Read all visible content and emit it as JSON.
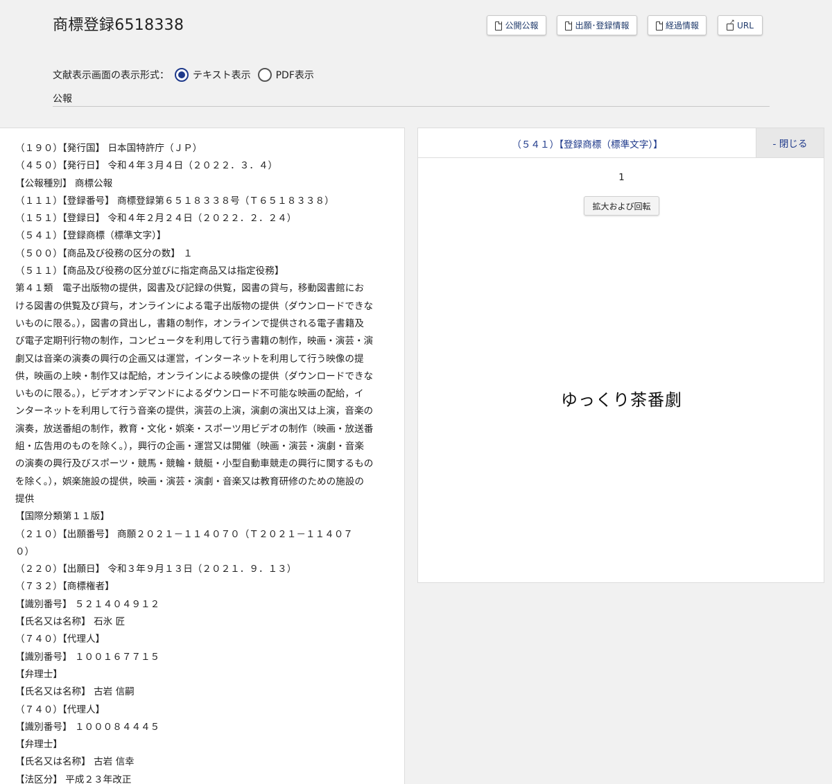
{
  "header": {
    "title": "商標登録6518338",
    "buttons": [
      {
        "label": "公開公報",
        "icon": "document-icon"
      },
      {
        "label": "出願･登録情報",
        "icon": "document-icon"
      },
      {
        "label": "経過情報",
        "icon": "document-icon"
      },
      {
        "label": "URL",
        "icon": "external-link-icon"
      }
    ]
  },
  "display_format": {
    "label": "文献表示画面の表示形式：",
    "options": [
      {
        "label": "テキスト表示",
        "selected": true
      },
      {
        "label": "PDF表示",
        "selected": false
      }
    ]
  },
  "section_label": "公報",
  "document_lines": [
    "（１９０）【発行国】 日本国特許庁（ＪＰ）",
    "（４５０）【発行日】 令和４年３月４日（２０２２．３．４）",
    "【公報種別】 商標公報",
    "（１１１）【登録番号】 商標登録第６５１８３３８号（Ｔ６５１８３３８）",
    "（１５１）【登録日】 令和４年２月２４日（２０２２．２．２４）",
    "（５４１）【登録商標（標準文字）】",
    "（５００）【商品及び役務の区分の数】 １",
    "（５１１）【商品及び役務の区分並びに指定商品又は指定役務】",
    "第４１類　電子出版物の提供，図書及び記録の供覧，図書の貸与，移動図書館にお",
    "ける図書の供覧及び貸与，オンラインによる電子出版物の提供（ダウンロードできな",
    "いものに限る。），図書の貸出し，書籍の制作，オンラインで提供される電子書籍及",
    "び電子定期刊行物の制作，コンピュータを利用して行う書籍の制作，映画・演芸・演",
    "劇又は音楽の演奏の興行の企画又は運営，インターネットを利用して行う映像の提",
    "供，映画の上映・制作又は配給，オンラインによる映像の提供（ダウンロードできな",
    "いものに限る。），ビデオオンデマンドによるダウンロード不可能な映画の配給，イ",
    "ンターネットを利用して行う音楽の提供，演芸の上演，演劇の演出又は上演，音楽の",
    "演奏，放送番組の制作，教育・文化・娯楽・スポーツ用ビデオの制作（映画・放送番",
    "組・広告用のものを除く。），興行の企画・運営又は開催（映画・演芸・演劇・音楽",
    "の演奏の興行及びスポーツ・競馬・競輪・競艇・小型自動車競走の興行に関するもの",
    "を除く。），娯楽施設の提供，映画・演芸・演劇・音楽又は教育研修のための施設の",
    "提供",
    "【国際分類第１１版】",
    "（２１０）【出願番号】 商願２０２１－１１４０７０（Ｔ２０２１－１１４０７",
    "０）",
    "（２２０）【出願日】 令和３年９月１３日（２０２１．９．１３）",
    "（７３２）【商標権者】",
    "【識別番号】 ５２１４０４９１２",
    "【氏名又は名称】 石氷 匠",
    "（７４０）【代理人】",
    "【識別番号】 １００１６７７１５",
    "【弁理士】",
    "【氏名又は名称】 古岩 信嗣",
    "（７４０）【代理人】",
    "【識別番号】 １０００８４４４５",
    "【弁理士】",
    "【氏名又は名称】 古岩 信幸",
    "【法区分】 平成２３年改正"
  ],
  "viewer": {
    "title": "（５４１）【登録商標（標準文字）】",
    "close_label": "- 閉じる",
    "page_number": "1",
    "zoom_label": "拡大および回転",
    "trademark_text": "ゆっくり茶番劇"
  },
  "colors": {
    "background": "#f1f1f1",
    "accent": "#1f3a8b"
  }
}
